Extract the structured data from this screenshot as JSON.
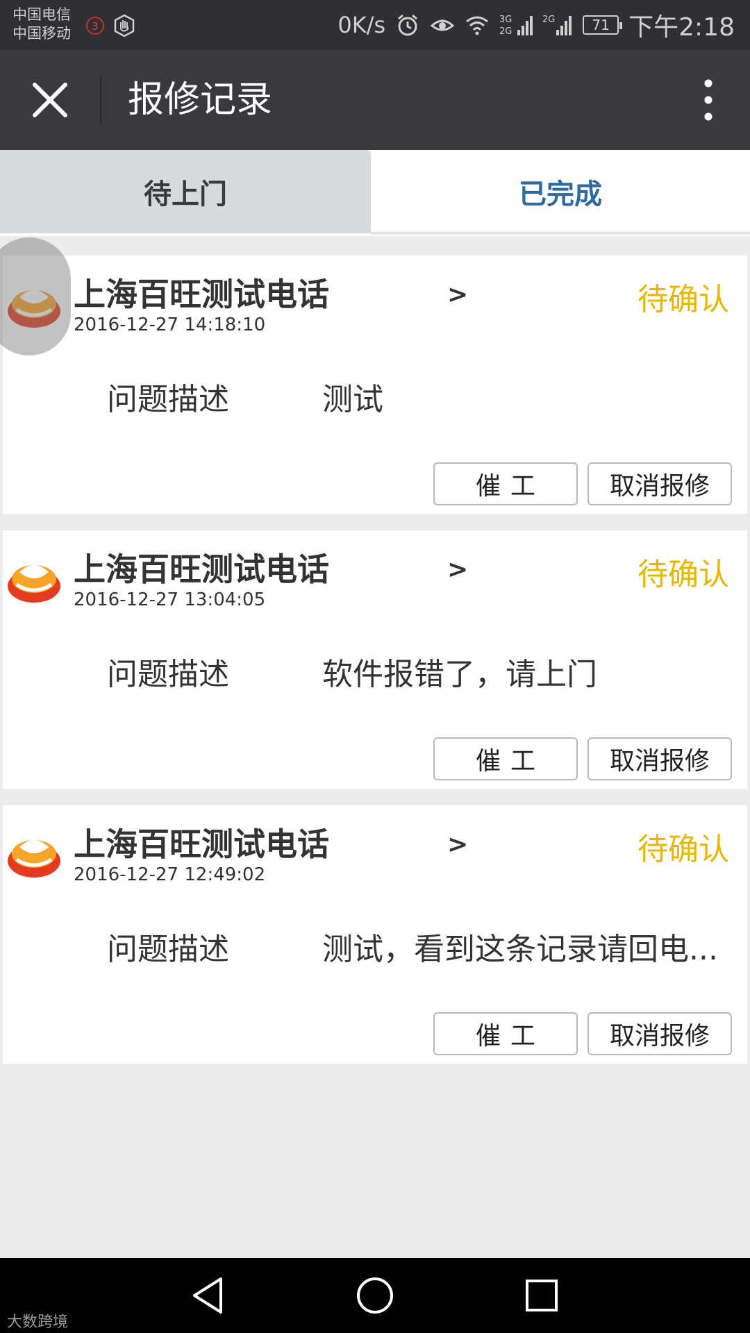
{
  "status_bar": {
    "carrier_1": "中国电信",
    "carrier_2": "中国移动",
    "sim_badge": "3",
    "net_speed": "0K/s",
    "net_type_1": "3G",
    "net_type_2": "2G",
    "battery": "71",
    "clock": "下午2:18"
  },
  "title_bar": {
    "title": "报修记录",
    "close_icon": "close-icon",
    "more_icon": "more-vertical-icon"
  },
  "tabs": [
    {
      "label": "待上门",
      "active": true
    },
    {
      "label": "已完成",
      "active": false
    }
  ],
  "colors": {
    "status_pending": "#e6b800",
    "tab_active_bg": "#d5dbdf",
    "tab_inactive_text": "#2c6aa0",
    "titlebar_bg": "#393a3f"
  },
  "records": [
    {
      "provider": "上海百旺测试电话",
      "arrow": ">",
      "timestamp": "2016-12-27 14:18:10",
      "status": "待确认",
      "desc_label": "问题描述",
      "desc_value": "测试",
      "urge_label": "催工",
      "cancel_label": "取消报修"
    },
    {
      "provider": "上海百旺测试电话",
      "arrow": ">",
      "timestamp": "2016-12-27 13:04:05",
      "status": "待确认",
      "desc_label": "问题描述",
      "desc_value": "软件报错了，请上门",
      "urge_label": "催工",
      "cancel_label": "取消报修"
    },
    {
      "provider": "上海百旺测试电话",
      "arrow": ">",
      "timestamp": "2016-12-27 12:49:02",
      "status": "待确认",
      "desc_label": "问题描述",
      "desc_value": "测试，看到这条记录请回电...",
      "urge_label": "催工",
      "cancel_label": "取消报修"
    }
  ],
  "nav_bar": {
    "back_icon": "back-triangle-icon",
    "home_icon": "home-circle-icon",
    "recents_icon": "recents-square-icon"
  },
  "watermark": "大数跨境"
}
